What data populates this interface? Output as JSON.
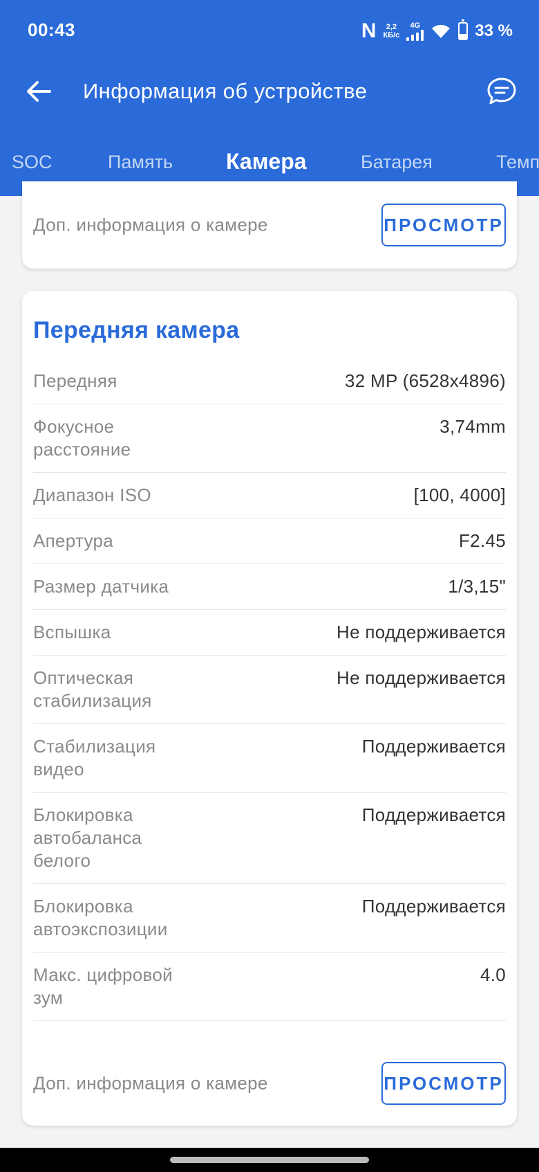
{
  "status_bar": {
    "time": "00:43",
    "speed_value": "2,2",
    "speed_unit": "КБ/с",
    "network": "4G",
    "battery": "33 %",
    "battery_level": 0.33
  },
  "toolbar": {
    "title": "Информация об устройстве",
    "back_icon": "arrow-left-icon",
    "feedback_icon": "chat-bubble-icon"
  },
  "tabs": [
    {
      "label": "SOC",
      "active": false
    },
    {
      "label": "Память",
      "active": false
    },
    {
      "label": "Камера",
      "active": true
    },
    {
      "label": "Батарея",
      "active": false
    },
    {
      "label": "Темп",
      "active": false
    }
  ],
  "rear_card": {
    "more_label": "Доп. информация о камере",
    "more_button": "ПРОСМОТР"
  },
  "front_card": {
    "title": "Передняя камера",
    "rows": [
      {
        "key": "Передняя",
        "value": "32 MP (6528x4896)"
      },
      {
        "key": "Фокусное расстояние",
        "value": "3,74mm"
      },
      {
        "key": "Диапазон ISO",
        "value": "[100, 4000]"
      },
      {
        "key": "Апертура",
        "value": "F2.45"
      },
      {
        "key": "Размер датчика",
        "value": "1/3,15\""
      },
      {
        "key": "Вспышка",
        "value": "Не поддерживается"
      },
      {
        "key": "Оптическая стабилизация",
        "value": "Не поддерживается"
      },
      {
        "key": "Стабилизация видео",
        "value": "Поддерживается"
      },
      {
        "key": "Блокировка автобаланса белого",
        "value": "Поддерживается"
      },
      {
        "key": "Блокировка автоэкспозиции",
        "value": "Поддерживается"
      },
      {
        "key": "Макс. цифровой зум",
        "value": "4.0"
      }
    ],
    "more_label": "Доп. информация о камере",
    "more_button": "ПРОСМОТР"
  },
  "colors": {
    "accent": "#2a6bd9",
    "background": "#f2f3f5"
  }
}
